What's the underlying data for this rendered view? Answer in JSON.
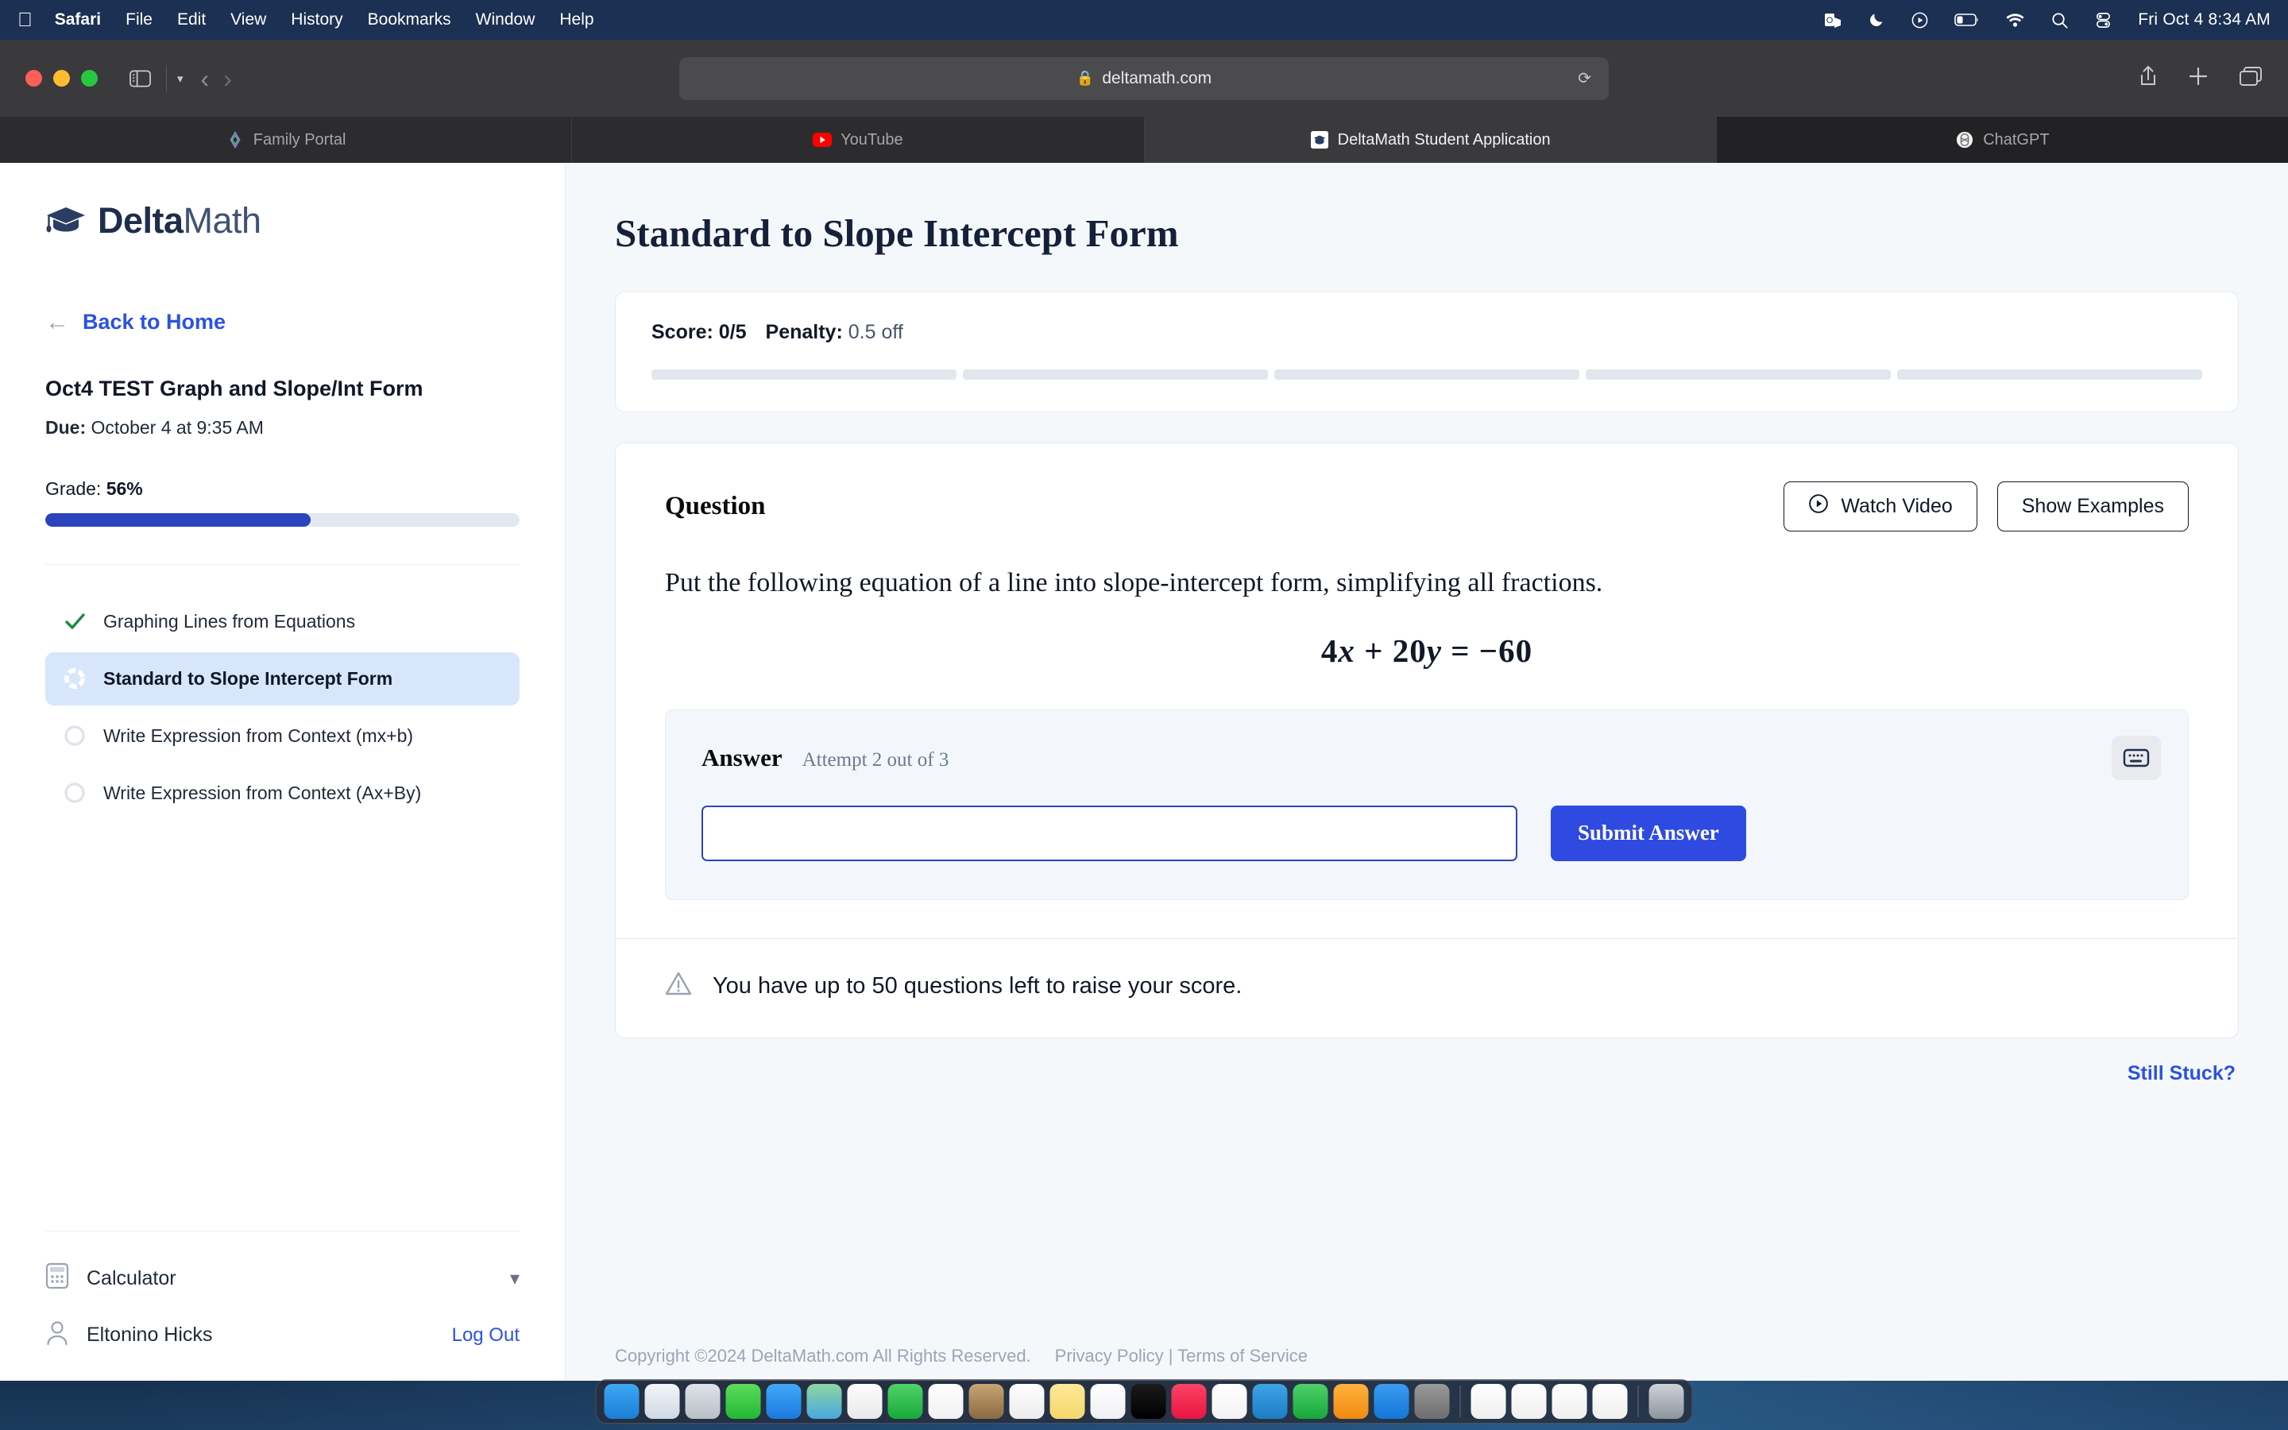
{
  "menubar": {
    "apple_icon": "apple-icon",
    "items": [
      "Safari",
      "File",
      "Edit",
      "View",
      "History",
      "Bookmarks",
      "Window",
      "Help"
    ],
    "status_icons": [
      "outlook-icon",
      "moon-icon",
      "play-circle-icon",
      "battery-icon",
      "wifi-icon",
      "search-icon",
      "control-center-icon"
    ],
    "clock": "Fri Oct 4  8:34 AM"
  },
  "browser": {
    "url": "deltamath.com",
    "lock_icon": "lock-icon",
    "reload_icon": "reload-icon",
    "sidebar_icon": "sidebar-icon",
    "back_icon": "back-chevron-icon",
    "forward_icon": "forward-chevron-icon",
    "share_icon": "share-icon",
    "new_tab_icon": "plus-icon",
    "tab_overview_icon": "tabs-icon",
    "tabs": [
      {
        "label": "Family Portal",
        "favicon": "family-portal-icon",
        "state": "inactive"
      },
      {
        "label": "YouTube",
        "favicon": "youtube-icon",
        "state": "inactive"
      },
      {
        "label": "DeltaMath Student Application",
        "favicon": "deltamath-icon",
        "state": "active"
      },
      {
        "label": "ChatGPT",
        "favicon": "chatgpt-icon",
        "state": "inactive"
      }
    ]
  },
  "sidebar": {
    "logo_text_bold": "Delta",
    "logo_text_light": "Math",
    "logo_icon": "graduation-cap-icon",
    "back_label": "Back to Home",
    "back_arrow_icon": "arrow-left-icon",
    "assignment_title": "Oct4 TEST Graph and Slope/Int Form",
    "due_label": "Due:",
    "due_value": "October 4 at 9:35 AM",
    "grade_label": "Grade:",
    "grade_value": "56%",
    "grade_percent": 56,
    "topics": [
      {
        "label": "Graphing Lines from Equations",
        "status": "complete",
        "icon": "check-icon"
      },
      {
        "label": "Standard to Slope Intercept Form",
        "status": "active",
        "icon": "progress-ring-icon"
      },
      {
        "label": "Write Expression from Context (mx+b)",
        "status": "todo",
        "icon": "empty-circle-icon"
      },
      {
        "label": "Write Expression from Context (Ax+By)",
        "status": "todo",
        "icon": "empty-circle-icon"
      }
    ],
    "calculator_label": "Calculator",
    "calculator_icon": "calculator-icon",
    "calculator_chevron": "chevron-down-icon",
    "user_name": "Eltonino Hicks",
    "user_icon": "person-icon",
    "logout_label": "Log Out"
  },
  "main": {
    "page_title": "Standard to Slope Intercept Form",
    "score": {
      "score_label": "Score:",
      "score_value": "0/5",
      "penalty_label": "Penalty:",
      "penalty_value": "0.5 off",
      "segments": 5,
      "segments_filled": 0
    },
    "question": {
      "heading": "Question",
      "watch_video_label": "Watch Video",
      "watch_video_icon": "play-circle-icon",
      "show_examples_label": "Show Examples",
      "prompt": "Put the following equation of a line into slope-intercept form, simplifying all fractions.",
      "equation": {
        "coefficient_x": "4",
        "var_x": "x",
        "operator_1": "+",
        "coefficient_y": "20",
        "var_y": "y",
        "equals": "=",
        "right_side": "−60",
        "plain": "4x + 20y = −60"
      }
    },
    "answer": {
      "label": "Answer",
      "attempt_text": "Attempt 2 out of 3",
      "input_value": "",
      "input_placeholder": "",
      "submit_label": "Submit Answer",
      "keyboard_icon": "keyboard-icon"
    },
    "notice": {
      "icon": "warning-triangle-icon",
      "text": "You have up to 50 questions left to raise your score."
    },
    "still_stuck_label": "Still Stuck?",
    "footer": {
      "copyright": "Copyright ©2024 DeltaMath.com All Rights Reserved.",
      "links": "Privacy Policy | Terms of Service"
    }
  },
  "dock": {
    "icons": [
      "finder-icon",
      "safari-icon",
      "launchpad-icon",
      "messages-icon",
      "mail-icon",
      "maps-icon",
      "photos-icon",
      "facetime-icon",
      "calendar-icon",
      "contacts-icon",
      "reminders-icon",
      "notes-icon",
      "freeform-icon",
      "appletv-icon",
      "music-icon",
      "news-icon",
      "keynote-icon",
      "numbers-icon",
      "pages-icon",
      "appstore-icon",
      "chatgpt-icon"
    ],
    "icons_group2": [
      "powerpoint-icon",
      "word-icon",
      "outlook-icon",
      "chrome-icon"
    ],
    "trash_icon": "trash-icon"
  },
  "colors": {
    "accent_blue": "#2b52e0",
    "submit_blue": "#2f4ae0",
    "progress_blue": "#2b44bd",
    "active_topic_bg": "#d8e6fb",
    "check_green": "#1c8a45",
    "page_bg": "#f5f8fb",
    "menubar_bg": "#1b3052"
  }
}
